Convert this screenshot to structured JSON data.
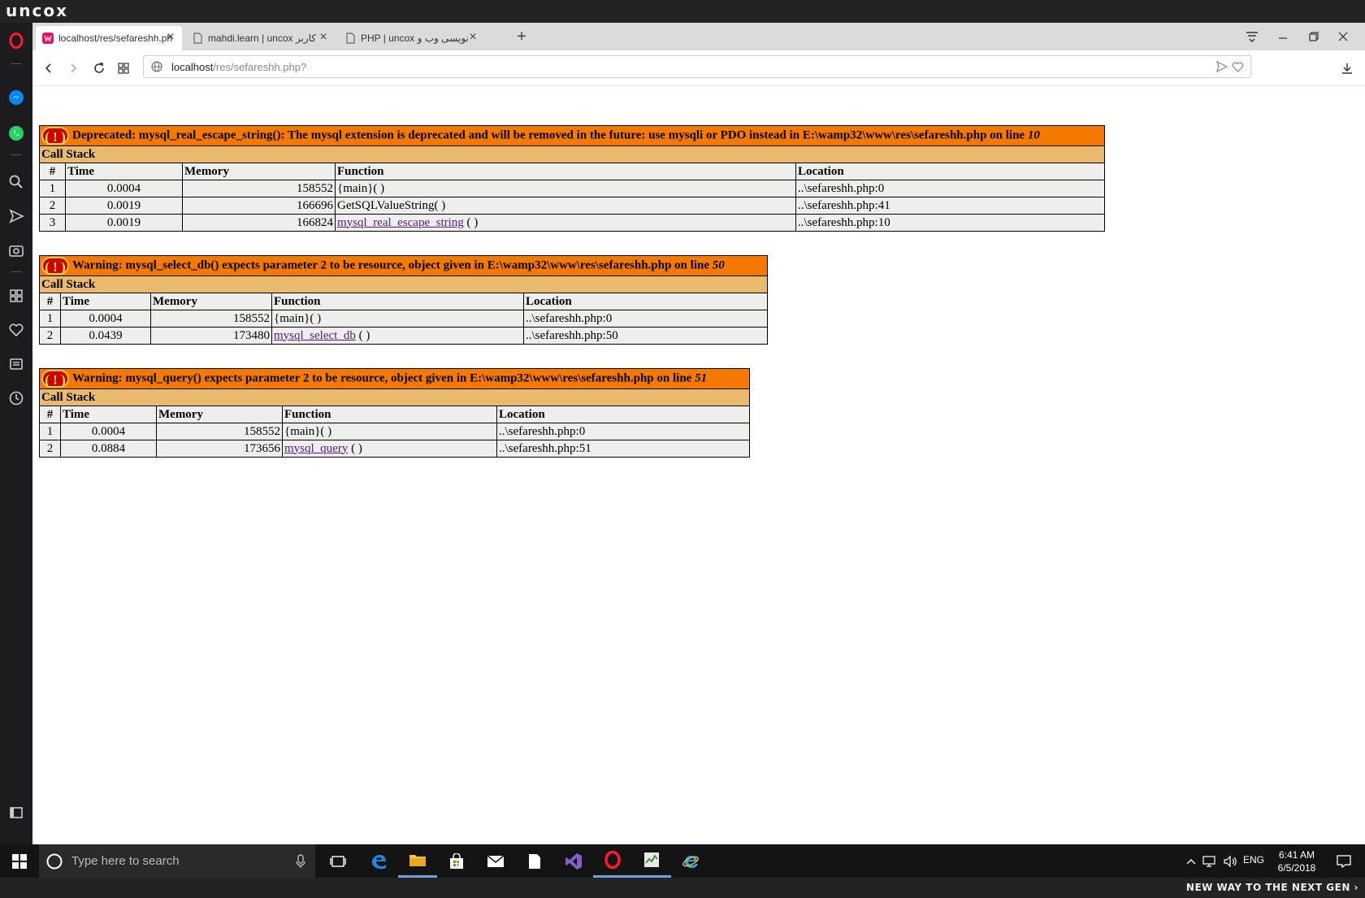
{
  "watermark": {
    "logo": "uncox",
    "slogan": "NEW WAY TO THE NEXT GEN ›"
  },
  "tabs": [
    {
      "label": "localhost/res/sefareshh.ph",
      "active": true
    },
    {
      "label": "mahdi.learn | uncox کاربر",
      "active": false
    },
    {
      "label": "PHP | uncox نویسی وب و",
      "active": false
    }
  ],
  "address": {
    "host": "localhost",
    "path": "/res/sefareshh.php?"
  },
  "headers": {
    "hash": "#",
    "time": "Time",
    "memory": "Memory",
    "function": "Function",
    "location": "Location",
    "call_stack": "Call Stack"
  },
  "errors": [
    {
      "message": "Deprecated: mysql_real_escape_string(): The mysql extension is deprecated and will be removed in the future: use mysqli or PDO instead in E:\\wamp32\\www\\res\\sefareshh.php on line",
      "line": "10",
      "rows": [
        {
          "num": "1",
          "time": "0.0004",
          "memory": "158552",
          "function": "{main}( )",
          "link": false,
          "location": "..\\sefareshh.php:0"
        },
        {
          "num": "2",
          "time": "0.0019",
          "memory": "166696",
          "function": "GetSQLValueString( )",
          "link": false,
          "location": "..\\sefareshh.php:41"
        },
        {
          "num": "3",
          "time": "0.0019",
          "memory": "166824",
          "function": "mysql_real_escape_string",
          "suffix": " ( )",
          "link": true,
          "location": "..\\sefareshh.php:10"
        }
      ]
    },
    {
      "message": "Warning: mysql_select_db() expects parameter 2 to be resource, object given in E:\\wamp32\\www\\res\\sefareshh.php on line",
      "line": "50",
      "rows": [
        {
          "num": "1",
          "time": "0.0004",
          "memory": "158552",
          "function": "{main}( )",
          "link": false,
          "location": "..\\sefareshh.php:0"
        },
        {
          "num": "2",
          "time": "0.0439",
          "memory": "173480",
          "function": "mysql_select_db",
          "suffix": " ( )",
          "link": true,
          "location": "..\\sefareshh.php:50"
        }
      ]
    },
    {
      "message": "Warning: mysql_query() expects parameter 2 to be resource, object given in E:\\wamp32\\www\\res\\sefareshh.php on line",
      "line": "51",
      "rows": [
        {
          "num": "1",
          "time": "0.0004",
          "memory": "158552",
          "function": "{main}( )",
          "link": false,
          "location": "..\\sefareshh.php:0"
        },
        {
          "num": "2",
          "time": "0.0884",
          "memory": "173656",
          "function": "mysql_query",
          "suffix": " ( )",
          "link": true,
          "location": "..\\sefareshh.php:51"
        }
      ]
    }
  ],
  "taskbar": {
    "search_placeholder": "Type here to search",
    "lang": "ENG",
    "time": "6:41 AM",
    "date": "6/5/2018"
  }
}
